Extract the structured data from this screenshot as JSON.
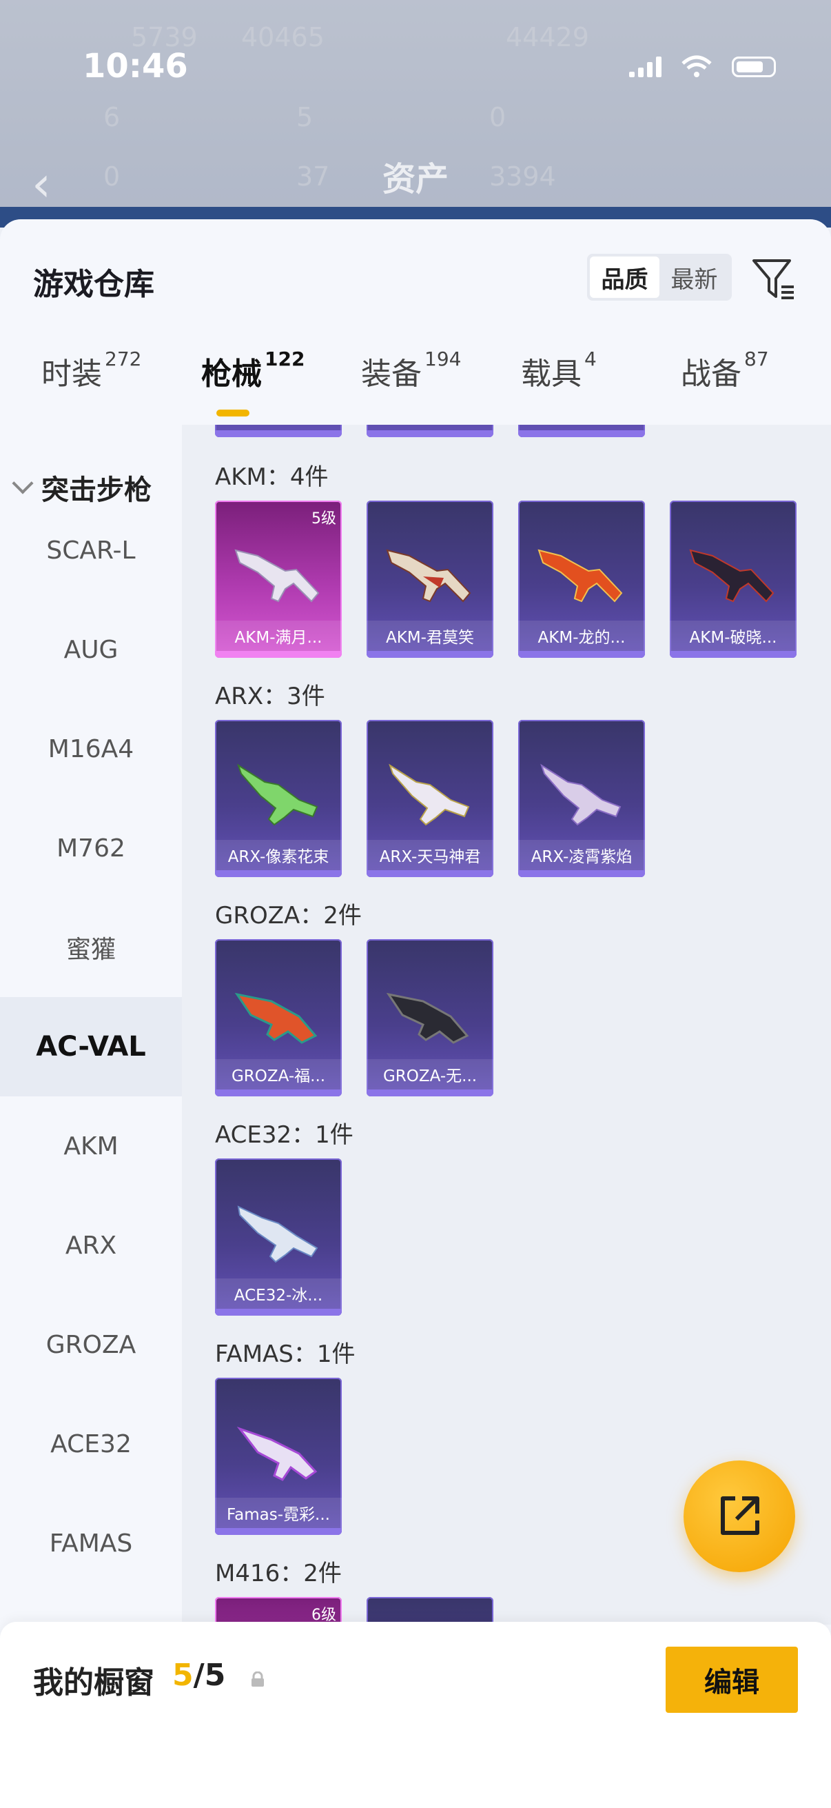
{
  "status_bar": {
    "time": "10:46"
  },
  "background": {
    "title": "资产",
    "stats": [
      "5739",
      "40465",
      "44429",
      "6",
      "5",
      "0",
      "0",
      "37",
      "3394"
    ]
  },
  "sheet": {
    "title": "游戏仓库",
    "sort": {
      "options": [
        "品质",
        "最新"
      ],
      "selected": "品质"
    }
  },
  "tabs": [
    {
      "label": "时装",
      "count": "272"
    },
    {
      "label": "枪械",
      "count": "122",
      "active": true
    },
    {
      "label": "装备",
      "count": "194"
    },
    {
      "label": "载具",
      "count": "4"
    },
    {
      "label": "战备",
      "count": "87"
    }
  ],
  "sidebar": {
    "category": "突击步枪",
    "items": [
      "SCAR-L",
      "AUG",
      "M16A4",
      "M762",
      "蜜獾",
      "AC-VAL",
      "AKM",
      "ARX",
      "GROZA",
      "ACE32",
      "FAMAS"
    ],
    "active": "AC-VAL"
  },
  "groups": [
    {
      "title": "AKM：4件",
      "items": [
        {
          "name": "AKM-满月...",
          "level": "5级",
          "rarity": "pink"
        },
        {
          "name": "AKM-君莫笑",
          "rarity": "purple"
        },
        {
          "name": "AKM-龙的...",
          "rarity": "purple"
        },
        {
          "name": "AKM-破晓...",
          "rarity": "purple"
        }
      ]
    },
    {
      "title": "ARX：3件",
      "items": [
        {
          "name": "ARX-像素花束",
          "rarity": "purple"
        },
        {
          "name": "ARX-天马神君",
          "rarity": "purple"
        },
        {
          "name": "ARX-凌霄紫焰",
          "rarity": "purple"
        }
      ]
    },
    {
      "title": "GROZA：2件",
      "items": [
        {
          "name": "GROZA-福...",
          "rarity": "purple"
        },
        {
          "name": "GROZA-无...",
          "rarity": "purple"
        }
      ]
    },
    {
      "title": "ACE32：1件",
      "items": [
        {
          "name": "ACE32-冰...",
          "rarity": "purple"
        }
      ]
    },
    {
      "title": "FAMAS：1件",
      "items": [
        {
          "name": "Famas-霓彩...",
          "rarity": "purple"
        }
      ]
    },
    {
      "title": "M416：2件",
      "items": [
        {
          "name": "",
          "level": "6级",
          "rarity": "pink"
        },
        {
          "name": "",
          "rarity": "purple"
        }
      ]
    }
  ],
  "showcase": {
    "label": "我的橱窗",
    "current": "5",
    "total": "/5",
    "edit_label": "编辑"
  },
  "colors": {
    "accent": "#f5b20a",
    "purple_card": "#4a3f8c",
    "pink_card": "#b03bb0"
  },
  "icons": [
    "filter-icon",
    "share-icon",
    "lock-icon",
    "back-icon",
    "chevron-down-icon"
  ]
}
